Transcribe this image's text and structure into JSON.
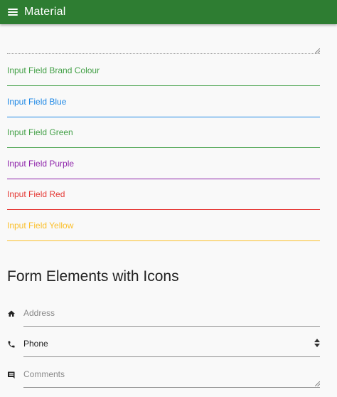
{
  "appbar": {
    "title": "Material",
    "menu_icon": "hamburger-menu-icon",
    "color": "#2e7d32"
  },
  "colored_fields": [
    {
      "label": "Input Field Brand Colour",
      "color": "#43a047"
    },
    {
      "label": "Input Field Blue",
      "color": "#1e88e5"
    },
    {
      "label": "Input Field Green",
      "color": "#43a047"
    },
    {
      "label": "Input Field Purple",
      "color": "#8e24aa"
    },
    {
      "label": "Input Field Red",
      "color": "#e53935"
    },
    {
      "label": "Input Field Yellow",
      "color": "#fbc02d"
    }
  ],
  "icons_section": {
    "title": "Form Elements with Icons",
    "address": {
      "placeholder": "Address",
      "icon": "home-icon"
    },
    "phone": {
      "selected_value": "Phone",
      "icon": "phone-icon"
    },
    "comments": {
      "placeholder": "Comments",
      "icon": "comment-icon"
    }
  }
}
